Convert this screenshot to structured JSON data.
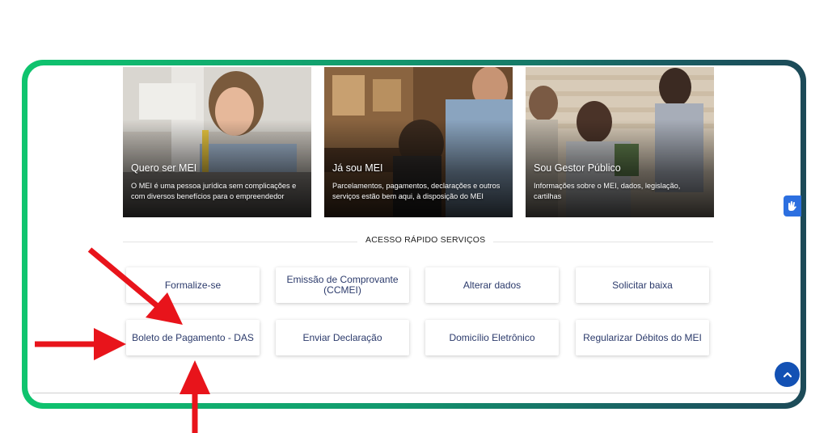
{
  "cards": [
    {
      "title": "Quero ser MEI",
      "description": "O MEI é uma pessoa jurídica sem complicações e com diversos benefícios para o empreendedor"
    },
    {
      "title": "Já sou MEI",
      "description": "Parcelamentos, pagamentos, declarações e outros serviços estão bem aqui, à disposição do MEI"
    },
    {
      "title": "Sou Gestor Público",
      "description": "Informações sobre o MEI, dados, legislação, cartilhas"
    }
  ],
  "quick_access": {
    "title": "ACESSO RÁPIDO SERVIÇOS",
    "services": [
      "Formalize-se",
      "Emissão de Comprovante (CCMEI)",
      "Alterar dados",
      "Solicitar baixa",
      "Boleto de Pagamento - DAS",
      "Enviar Declaração",
      "Domicílio Eletrônico",
      "Regularizar Débitos do MEI"
    ]
  },
  "colors": {
    "frame_gradient_start": "#0fc46e",
    "frame_gradient_end": "#1c4a58",
    "service_text": "#2b3a6b",
    "annotation_arrow": "#e8141b",
    "scroll_button": "#1351b4",
    "accessibility_button": "#2c6fe0"
  },
  "icons": {
    "accessibility": "sign-language-icon",
    "scroll_top": "chevron-up-icon",
    "annotation": "red-arrow-icon"
  }
}
